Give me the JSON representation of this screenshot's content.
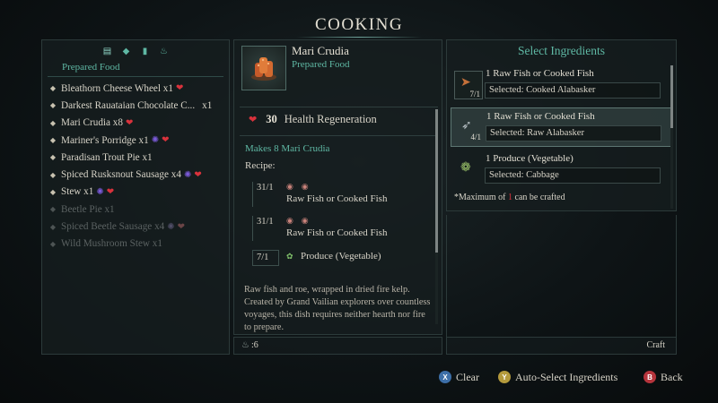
{
  "title": "COOKING",
  "categories": {
    "icons": [
      "scroll-icon",
      "food-icon",
      "drink-icon",
      "pot-icon"
    ],
    "active_label": "Prepared Food"
  },
  "foods": [
    {
      "name": "Bleathorn Cheese Wheel x1",
      "effects": [
        "heart"
      ],
      "dim": false
    },
    {
      "name": "Darkest Rauataian Chocolate C...",
      "qty": "x1",
      "effects": [],
      "dim": false
    },
    {
      "name": "Mari Crudia x8",
      "effects": [
        "heart"
      ],
      "dim": false
    },
    {
      "name": "Mariner's Porridge x1",
      "effects": [
        "swirl",
        "heart"
      ],
      "dim": false
    },
    {
      "name": "Paradisan Trout Pie x1",
      "effects": [],
      "dim": false
    },
    {
      "name": "Spiced Rusksnout Sausage x4",
      "effects": [
        "swirl",
        "heart"
      ],
      "dim": false
    },
    {
      "name": "Stew x1",
      "effects": [
        "swirl",
        "heart"
      ],
      "dim": false
    },
    {
      "name": "Beetle Pie x1",
      "effects": [],
      "dim": true
    },
    {
      "name": "Spiced Beetle Sausage x4",
      "effects": [
        "swirl",
        "heart"
      ],
      "dim": true
    },
    {
      "name": "Wild Mushroom Stew x1",
      "effects": [],
      "dim": true
    }
  ],
  "dish": {
    "name": "Mari Crudia",
    "category": "Prepared Food",
    "effect_value": "30",
    "effect_label": "Health Regeneration",
    "makes": "Makes 8 Mari Crudia",
    "recipe_label": "Recipe:",
    "recipe": [
      {
        "count": "31/1",
        "name": "Raw Fish or Cooked Fish"
      },
      {
        "count": "31/1",
        "name": "Raw Fish or Cooked Fish"
      },
      {
        "count": "7/1",
        "name": "Produce (Vegetable)"
      }
    ],
    "description": "Raw fish and roe, wrapped in dried fire kelp. Created by Grand Vailian explorers over countless voyages, this dish requires neither hearth nor fire to prepare.",
    "count_label": ":6"
  },
  "ingredients": {
    "title": "Select Ingredients",
    "slots": [
      {
        "amount": "7/1",
        "name": "1 Raw Fish or Cooked Fish",
        "selected": "Selected: Cooked Alabasker",
        "active": false
      },
      {
        "amount": "4/1",
        "name": "1 Raw Fish or Cooked Fish",
        "selected": "Selected: Raw Alabasker",
        "active": true
      },
      {
        "amount": "",
        "name": "1 Produce (Vegetable)",
        "selected": "Selected: Cabbage",
        "active": false
      }
    ],
    "max_prefix": "*Maximum of ",
    "max_value": "1",
    "max_suffix": " can be crafted",
    "craft_label": "Craft"
  },
  "footer": {
    "clear": {
      "button": "X",
      "label": "Clear"
    },
    "auto": {
      "button": "Y",
      "label": "Auto-Select Ingredients"
    },
    "back": {
      "button": "B",
      "label": "Back"
    }
  },
  "colors": {
    "accent": "#5fb8a4",
    "heart": "#d9323c",
    "swirl": "#7a5ad8"
  }
}
